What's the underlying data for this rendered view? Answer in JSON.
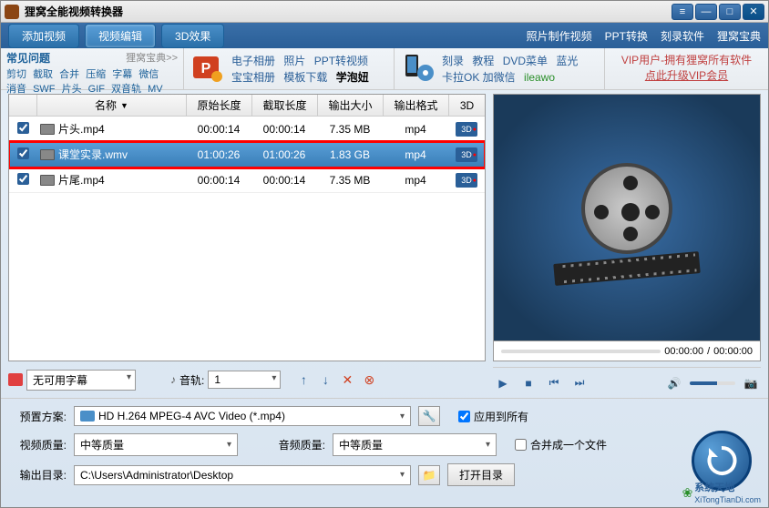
{
  "title": "狸窝全能视频转换器",
  "tabs": {
    "add": "添加视频",
    "edit": "视频编辑",
    "fx": "3D效果"
  },
  "toolbar_links": {
    "photo": "照片制作视频",
    "ppt": "PPT转换",
    "burn": "刻录软件",
    "guide": "狸窝宝典"
  },
  "faq": {
    "title": "常见问题",
    "link": "狸窝宝典>>",
    "tags1": [
      "剪切",
      "截取",
      "合并",
      "压缩",
      "字幕",
      "微信"
    ],
    "tags2": [
      "消音",
      "SWF",
      "片头",
      "GIF",
      "双音轨",
      "MV"
    ]
  },
  "promo1": {
    "line1": [
      "电子相册",
      "照片",
      "PPT转视频"
    ],
    "line2": [
      "宝宝相册",
      "模板下载"
    ],
    "bold": "学泡妞"
  },
  "promo2": {
    "line1": [
      "刻录",
      "教程",
      "DVD菜单",
      "蓝光"
    ],
    "line2_pre": "卡拉OK 加微信",
    "line2_green": "ileawo"
  },
  "vip": {
    "line1": "VIP用户-拥有狸窝所有软件",
    "line2": "点此升级VIP会员"
  },
  "columns": {
    "name": "名称",
    "orig": "原始长度",
    "cut": "截取长度",
    "size": "输出大小",
    "fmt": "输出格式",
    "td": "3D"
  },
  "files": [
    {
      "checked": true,
      "name": "片头.mp4",
      "orig": "00:00:14",
      "cut": "00:00:14",
      "size": "7.35 MB",
      "fmt": "mp4",
      "selected": false
    },
    {
      "checked": true,
      "name": "课堂实录.wmv",
      "orig": "01:00:26",
      "cut": "01:00:26",
      "size": "1.83 GB",
      "fmt": "mp4",
      "selected": true
    },
    {
      "checked": true,
      "name": "片尾.mp4",
      "orig": "00:00:14",
      "cut": "00:00:14",
      "size": "7.35 MB",
      "fmt": "mp4",
      "selected": false
    }
  ],
  "badge3d": "3D",
  "subtitle": {
    "value": "无可用字幕"
  },
  "audio": {
    "label": "音轨:",
    "value": "1"
  },
  "time": {
    "cur": "00:00:00",
    "total": "00:00:00"
  },
  "preset": {
    "label": "预置方案:",
    "value": "HD H.264 MPEG-4 AVC Video (*.mp4)"
  },
  "vquality": {
    "label": "视频质量:",
    "value": "中等质量"
  },
  "aquality": {
    "label": "音频质量:",
    "value": "中等质量"
  },
  "applyall": "应用到所有",
  "mergeone": "合并成一个文件",
  "output": {
    "label": "输出目录:",
    "value": "C:\\Users\\Administrator\\Desktop"
  },
  "open": "打开目录",
  "watermark": {
    "name": "系统天地",
    "url": "XiTongTianDi.com"
  }
}
